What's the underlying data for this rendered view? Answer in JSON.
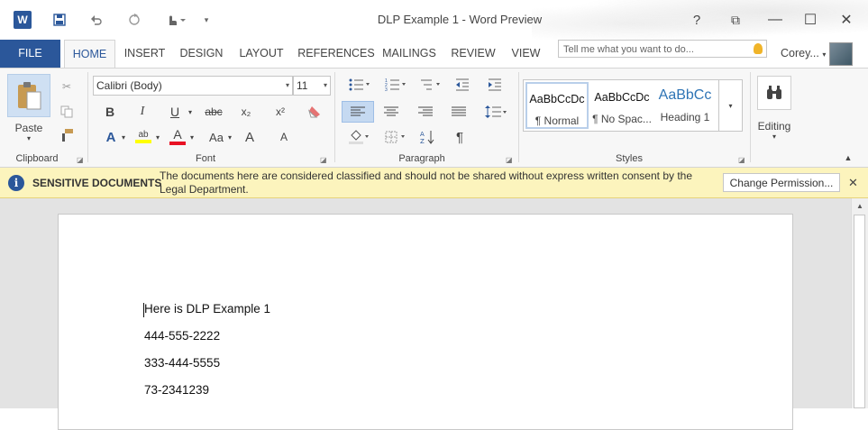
{
  "app": {
    "window_title": "DLP Example 1 - Word Preview",
    "logo_letter": "W"
  },
  "quick_access": {
    "save_icon": "save-icon",
    "undo_icon": "undo-icon",
    "redo_icon": "redo-icon",
    "touch_icon": "touch-mode-icon",
    "customize_icon": "customize-icon"
  },
  "window_controls": {
    "help": "?",
    "restore_ribbon": "⧉",
    "minimize": "—",
    "maximize": "☐",
    "close": "✕"
  },
  "tabs": [
    {
      "label": "FILE"
    },
    {
      "label": "HOME"
    },
    {
      "label": "INSERT"
    },
    {
      "label": "DESIGN"
    },
    {
      "label": "LAYOUT"
    },
    {
      "label": "REFERENCES"
    },
    {
      "label": "MAILINGS"
    },
    {
      "label": "REVIEW"
    },
    {
      "label": "VIEW"
    }
  ],
  "tell_me": {
    "placeholder": "Tell me what you want to do..."
  },
  "user": {
    "name": "Corey..."
  },
  "ribbon": {
    "clipboard": {
      "paste_label": "Paste",
      "group_label": "Clipboard"
    },
    "font": {
      "font_name": "Calibri (Body)",
      "font_size": "11",
      "group_label": "Font",
      "bold": "B",
      "italic": "I",
      "underline": "U",
      "strike": "abc",
      "subscript": "x₂",
      "superscript": "x²",
      "change_case": "Aa",
      "grow": "A",
      "shrink": "A"
    },
    "paragraph": {
      "group_label": "Paragraph",
      "pilcrow": "¶"
    },
    "styles": {
      "group_label": "Styles",
      "items": [
        {
          "sample": "AaBbCcDc",
          "name": "¶ Normal"
        },
        {
          "sample": "AaBbCcDc",
          "name": "¶ No Spac..."
        },
        {
          "sample": "AaBbCc",
          "name": "Heading 1"
        }
      ]
    },
    "editing": {
      "label": "Editing"
    }
  },
  "message_bar": {
    "title": "SENSITIVE DOCUMENTS",
    "text": "The documents here are considered classified and should not be shared without express written consent by the Legal Department.",
    "button_label": "Change Permission...",
    "close": "✕"
  },
  "document": {
    "lines": [
      "Here is DLP Example 1",
      "444-555-2222",
      "333-444-5555",
      "73-2341239"
    ]
  },
  "colors": {
    "accent": "#2b579a",
    "message_bar_bg": "#fcf4bd",
    "highlight": "#ffff00",
    "font_color": "#e81123"
  }
}
